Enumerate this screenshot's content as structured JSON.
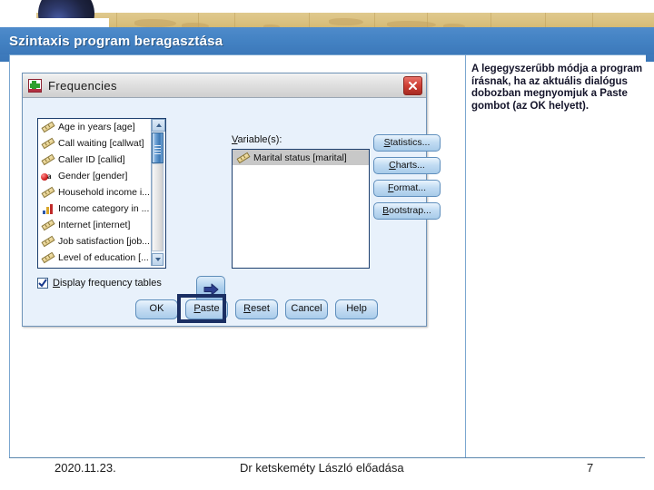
{
  "slide": {
    "title": "Szintaxis program beragasztása",
    "note": "A legegyszerűbb módja a program írásnak, ha az aktuális dialógus dobozban megnyomjuk a Paste gombot (az OK helyett).",
    "colors": {
      "title_band": "#4483c4",
      "banner_tan": "#d9bf7c",
      "highlight_box": "#1b2f63",
      "dialog_bg": "#e8f1fb"
    }
  },
  "dialog": {
    "title": "Frequencies",
    "icon": "spss-app-icon",
    "close_icon": "close-icon",
    "source_variables": [
      {
        "label": "Age in years [age]",
        "measure_icon": "scale-ruler-icon"
      },
      {
        "label": "Call waiting [callwat]",
        "measure_icon": "scale-ruler-icon"
      },
      {
        "label": "Caller ID [callid]",
        "measure_icon": "scale-ruler-icon"
      },
      {
        "label": "Gender [gender]",
        "measure_icon": "nominal-icon"
      },
      {
        "label": "Household income i...",
        "measure_icon": "scale-ruler-icon"
      },
      {
        "label": "Income category in ...",
        "measure_icon": "ordinal-bars-icon"
      },
      {
        "label": "Internet [internet]",
        "measure_icon": "scale-ruler-icon"
      },
      {
        "label": "Job satisfaction [job...",
        "measure_icon": "scale-ruler-icon"
      },
      {
        "label": "Level of education [...",
        "measure_icon": "scale-ruler-icon"
      }
    ],
    "transfer_button_icon": "arrow-right-icon",
    "target": {
      "label": "Variable(s):",
      "label_accel": "V",
      "items": [
        {
          "label": "Marital status [marital]",
          "measure_icon": "scale-ruler-icon",
          "selected": true
        }
      ]
    },
    "side_buttons": [
      {
        "label": "Statistics...",
        "accel": "S"
      },
      {
        "label": "Charts...",
        "accel": "C"
      },
      {
        "label": "Format...",
        "accel": "F"
      },
      {
        "label": "Bootstrap...",
        "accel": "B"
      }
    ],
    "checkbox": {
      "label": "Display frequency tables",
      "accel": "D",
      "checked": true
    },
    "bottom_buttons": [
      {
        "label": "OK",
        "highlighted": false
      },
      {
        "label": "Paste",
        "highlighted": true
      },
      {
        "label": "Reset",
        "highlighted": false
      },
      {
        "label": "Cancel",
        "highlighted": false
      },
      {
        "label": "Help",
        "highlighted": false
      }
    ]
  },
  "footer": {
    "date": "2020.11.23.",
    "center": "Dr ketskeméty László előadása",
    "page": "7"
  }
}
